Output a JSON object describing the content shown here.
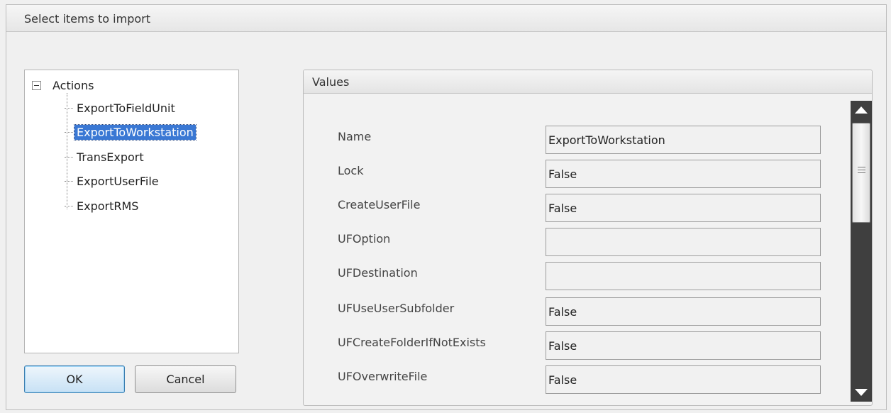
{
  "window": {
    "title": "Select items to import"
  },
  "tree": {
    "root": {
      "label": "Actions",
      "expanded": true
    },
    "items": [
      {
        "label": "ExportToFieldUnit",
        "selected": false
      },
      {
        "label": "ExportToWorkstation",
        "selected": true
      },
      {
        "label": "TransExport",
        "selected": false
      },
      {
        "label": "ExportUserFile",
        "selected": false
      },
      {
        "label": "ExportRMS",
        "selected": false
      }
    ]
  },
  "buttons": {
    "ok_label": "OK",
    "cancel_label": "Cancel"
  },
  "values": {
    "title": "Values",
    "properties": [
      {
        "name": "Name",
        "value": "ExportToWorkstation"
      },
      {
        "name": "Lock",
        "value": "False"
      },
      {
        "name": "CreateUserFile",
        "value": "False"
      },
      {
        "name": "UFOption",
        "value": ""
      },
      {
        "name": "UFDestination",
        "value": ""
      },
      {
        "name": "UFUseUserSubfolder",
        "value": "False"
      },
      {
        "name": "UFCreateFolderIfNotExists",
        "value": "False"
      },
      {
        "name": "UFOverwriteFile",
        "value": "False"
      }
    ]
  },
  "icons": {
    "tree_expander": "minus-box-icon",
    "scroll_up": "arrow-up-icon",
    "scroll_down": "arrow-down-icon",
    "scroll_grip": "grip-icon"
  },
  "colors": {
    "selection": "#3a78d4",
    "default_button_border": "#3c7fb1",
    "scrollbar_track": "#3f3f3f"
  }
}
